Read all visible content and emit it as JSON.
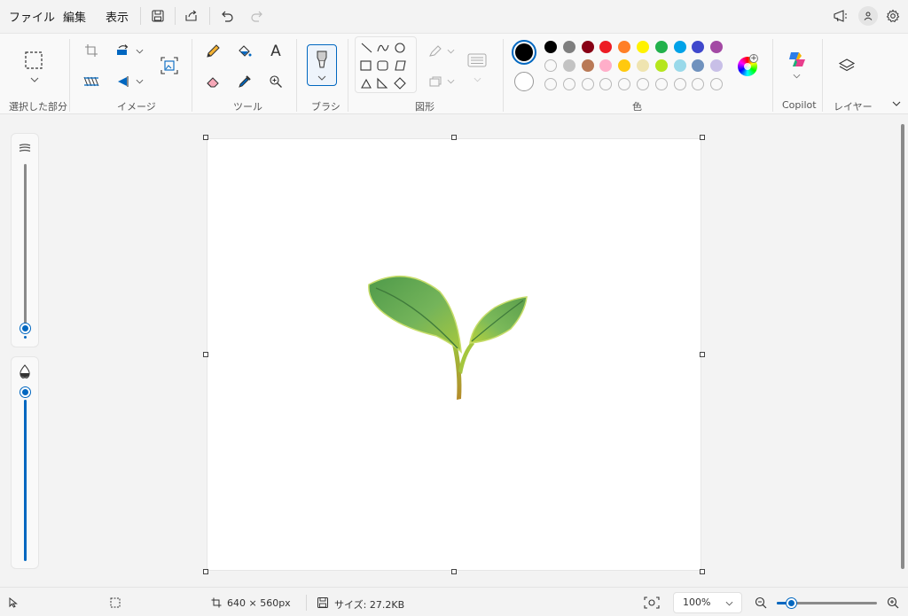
{
  "menu": {
    "file": "ファイル",
    "edit": "編集",
    "view": "表示"
  },
  "ribbon": {
    "groups": {
      "selection": "選択した部分",
      "image": "イメージ",
      "tools": "ツール",
      "brushes": "ブラシ",
      "shapes": "図形",
      "colors": "色",
      "copilot": "Copilot",
      "layers": "レイヤー"
    },
    "palette_row1": [
      "#000000",
      "#7f7f7f",
      "#880015",
      "#ed1c24",
      "#ff7f27",
      "#fff200",
      "#22b14c",
      "#00a2e8",
      "#3f48cc",
      "#a349a4"
    ],
    "palette_row2": [
      "",
      "#c3c3c3",
      "#b97a57",
      "#ffaec9",
      "#ffc90e",
      "#efe4b0",
      "#b5e61d",
      "#99d9ea",
      "#7092be",
      "#c8bfe7"
    ],
    "primary_color": "#000000",
    "secondary_color": "#ffffff"
  },
  "canvas": {
    "background": "#ffffff",
    "content": "plant sprout with two green leaves"
  },
  "status": {
    "dimensions": "640 × 560px",
    "size": "サイズ: 27.2KB",
    "zoom": "100%"
  },
  "accent_color": "#0067c0"
}
